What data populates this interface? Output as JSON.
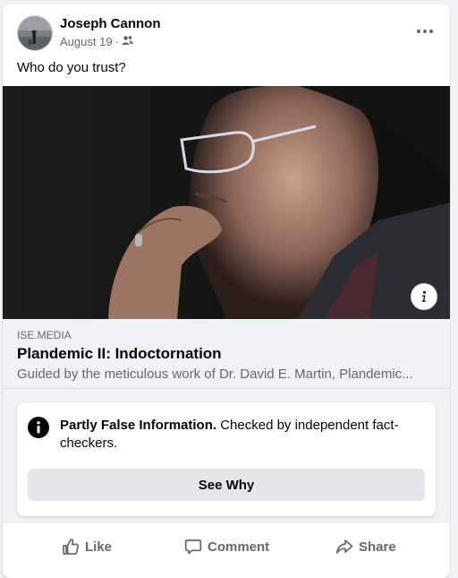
{
  "post": {
    "author": "Joseph Cannon",
    "date": "August 19",
    "separator": "·",
    "audience_icon": "friends-icon",
    "text": "Who do you trust?"
  },
  "link": {
    "domain": "ISE.MEDIA",
    "title": "Plandemic II: Indoctornation",
    "description": "Guided by the meticulous work of Dr. David E. Martin, Plandemic..."
  },
  "fact_check": {
    "rating": "Partly False Information.",
    "message": "Checked by independent fact-checkers.",
    "button_label": "See Why"
  },
  "actions": {
    "like": "Like",
    "comment": "Comment",
    "share": "Share"
  },
  "colors": {
    "background": "#f0f2f5",
    "secondary_text": "#65676b",
    "button_bg": "#e4e6eb"
  }
}
